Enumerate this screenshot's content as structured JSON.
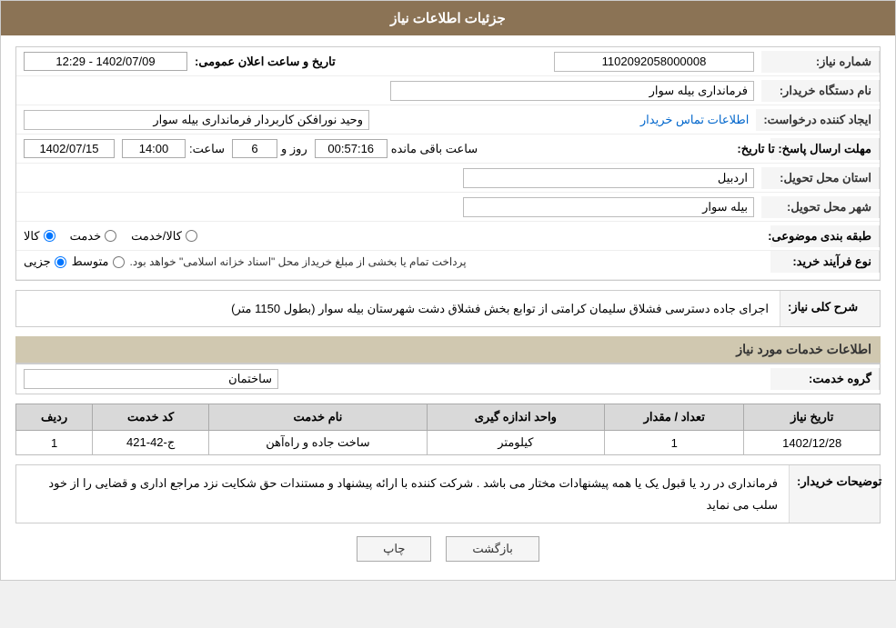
{
  "header": {
    "title": "جزئیات اطلاعات نیاز"
  },
  "fields": {
    "shmare_niaz_label": "شماره نیاز:",
    "shmare_niaz_value": "1102092058000008",
    "name_dastgah_label": "نام دستگاه خریدار:",
    "name_dastgah_value": "فرمانداری بیله سوار",
    "ijad_konande_label": "ایجاد کننده درخواست:",
    "ijad_konande_value": "وحید نورافکن کاربردار فرمانداری بیله سوار",
    "contact_link": "اطلاعات تماس خریدار",
    "mohlat_label": "مهلت ارسال پاسخ: تا تاریخ:",
    "mohlat_date": "1402/07/15",
    "mohlat_saat_label": "ساعت:",
    "mohlat_saat": "14:00",
    "mohlat_rooz_label": "روز و",
    "mohlat_rooz": "6",
    "mohlat_baqi_label": "ساعت باقی مانده",
    "mohlat_baqi": "00:57:16",
    "ostan_label": "استان محل تحویل:",
    "ostan_value": "اردبیل",
    "shahr_label": "شهر محل تحویل:",
    "shahr_value": "بیله سوار",
    "tabaqe_label": "طبقه بندی موضوعی:",
    "tabaqe_kala": "کالا",
    "tabaqe_khedmat": "خدمت",
    "tabaqe_kala_khedmat": "کالا/خدمت",
    "tabaqe_selected": "kala",
    "noow_label": "نوع فرآیند خرید:",
    "noow_jazzi": "جزیی",
    "noow_motavaset": "متوسط",
    "noow_text": "پرداخت تمام یا بخشی از مبلغ خریداز محل \"اسناد خزانه اسلامی\" خواهد بود.",
    "sharh_header": "شرح کلی نیاز:",
    "sharh_text": "اجرای جاده دسترسی فشلاق سلیمان کرامتی از توابع بخش فشلاق دشت شهرستان بیله سوار (بطول 1150 متر)",
    "etelaat_header": "اطلاعات خدمات مورد نیاز",
    "group_label": "گروه خدمت:",
    "group_value": "ساختمان",
    "table": {
      "col_radif": "ردیف",
      "col_kod": "کد خدمت",
      "col_name": "نام خدمت",
      "col_unit": "واحد اندازه گیری",
      "col_count": "تعداد / مقدار",
      "col_date": "تاریخ نیاز",
      "rows": [
        {
          "radif": "1",
          "kod": "ج-42-421",
          "name": "ساخت جاده و راه‌آهن",
          "unit": "کیلومتر",
          "count": "1",
          "date": "1402/12/28"
        }
      ]
    },
    "tawzihat_label": "توضیحات خریدار:",
    "tawzihat_text": "فرمانداری در رد یا قبول یک یا همه پیشنهادات مختار می باشد . شرکت کننده با ارائه پیشنهاد و مستندات حق شکایت نزد مراجع اداری و قضایی را از خود سلب می نماید",
    "btn_bazgasht": "بازگشت",
    "btn_chap": "چاپ"
  }
}
